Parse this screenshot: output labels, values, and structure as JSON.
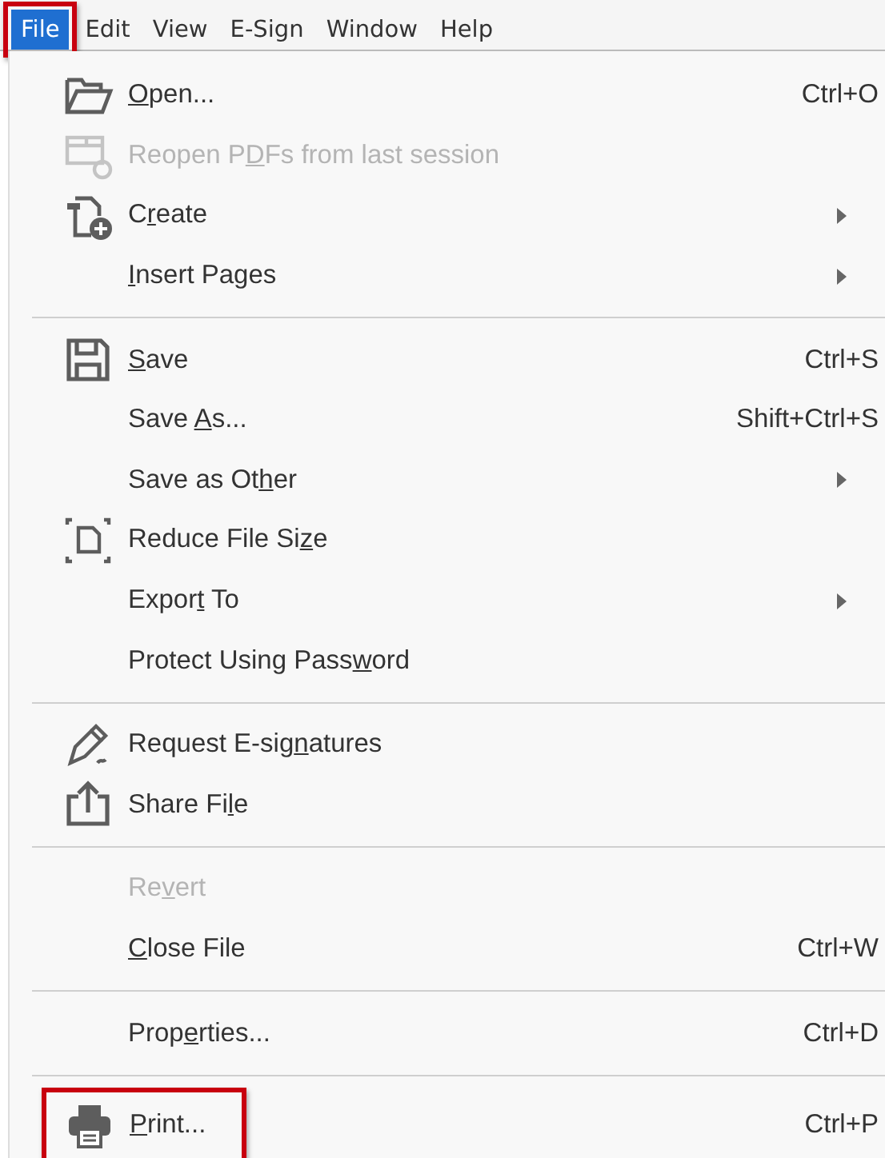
{
  "menubar": [
    {
      "label": "File",
      "selected": true,
      "highlighted": true
    },
    {
      "label": "Edit",
      "selected": false,
      "highlighted": false
    },
    {
      "label": "View",
      "selected": false,
      "highlighted": false
    },
    {
      "label": "E-Sign",
      "selected": false,
      "highlighted": false
    },
    {
      "label": "Window",
      "selected": false,
      "highlighted": false
    },
    {
      "label": "Help",
      "selected": false,
      "highlighted": false
    }
  ],
  "menu_sections": [
    [
      {
        "label": {
          "key": "O",
          "post": "pen..."
        },
        "shortcut": "Ctrl+O",
        "submenu": false,
        "disabled": false,
        "highlighted": false
      },
      {
        "label": {
          "pre": "Reopen P",
          "key": "D",
          "post": "Fs from last session"
        },
        "submenu": false,
        "disabled": true,
        "highlighted": false
      },
      {
        "label": {
          "pre": "C",
          "key": "r",
          "post": "eate"
        },
        "submenu": true,
        "disabled": false,
        "highlighted": false
      },
      {
        "label": {
          "key": "I",
          "post": "nsert Pages"
        },
        "submenu": true,
        "disabled": false,
        "highlighted": false
      }
    ],
    [
      {
        "label": {
          "key": "S",
          "post": "ave"
        },
        "shortcut": "Ctrl+S",
        "submenu": false,
        "disabled": false,
        "highlighted": false
      },
      {
        "label": {
          "pre": "Save ",
          "key": "A",
          "post": "s..."
        },
        "shortcut": "Shift+Ctrl+S",
        "submenu": false,
        "disabled": false,
        "highlighted": false
      },
      {
        "label": {
          "pre": "Save as Ot",
          "key": "h",
          "post": "er"
        },
        "submenu": true,
        "disabled": false,
        "highlighted": false
      },
      {
        "label": {
          "pre": "Reduce File Si",
          "key": "z",
          "post": "e"
        },
        "submenu": false,
        "disabled": false,
        "highlighted": false
      },
      {
        "label": {
          "pre": "Expor",
          "key": "t",
          "post": " To"
        },
        "submenu": true,
        "disabled": false,
        "highlighted": false
      },
      {
        "label": {
          "pre": "Protect Using Pass",
          "key": "w",
          "post": "ord"
        },
        "submenu": false,
        "disabled": false,
        "highlighted": false
      }
    ],
    [
      {
        "label": {
          "pre": "Request E-sig",
          "key": "n",
          "post": "atures"
        },
        "submenu": false,
        "disabled": false,
        "highlighted": false
      },
      {
        "label": {
          "pre": "Share Fi",
          "key": "l",
          "post": "e"
        },
        "submenu": false,
        "disabled": false,
        "highlighted": false
      }
    ],
    [
      {
        "label": {
          "pre": "Re",
          "key": "v",
          "post": "ert"
        },
        "submenu": false,
        "disabled": true,
        "highlighted": false
      },
      {
        "label": {
          "key": "C",
          "post": "lose File"
        },
        "shortcut": "Ctrl+W",
        "submenu": false,
        "disabled": false,
        "highlighted": false
      }
    ],
    [
      {
        "label": {
          "pre": "Prop",
          "key": "e",
          "post": "rties..."
        },
        "shortcut": "Ctrl+D",
        "submenu": false,
        "disabled": false,
        "highlighted": false
      }
    ],
    [
      {
        "label": {
          "key": "P",
          "post": "rint..."
        },
        "shortcut": "Ctrl+P",
        "submenu": false,
        "disabled": false,
        "highlighted": true
      }
    ]
  ]
}
